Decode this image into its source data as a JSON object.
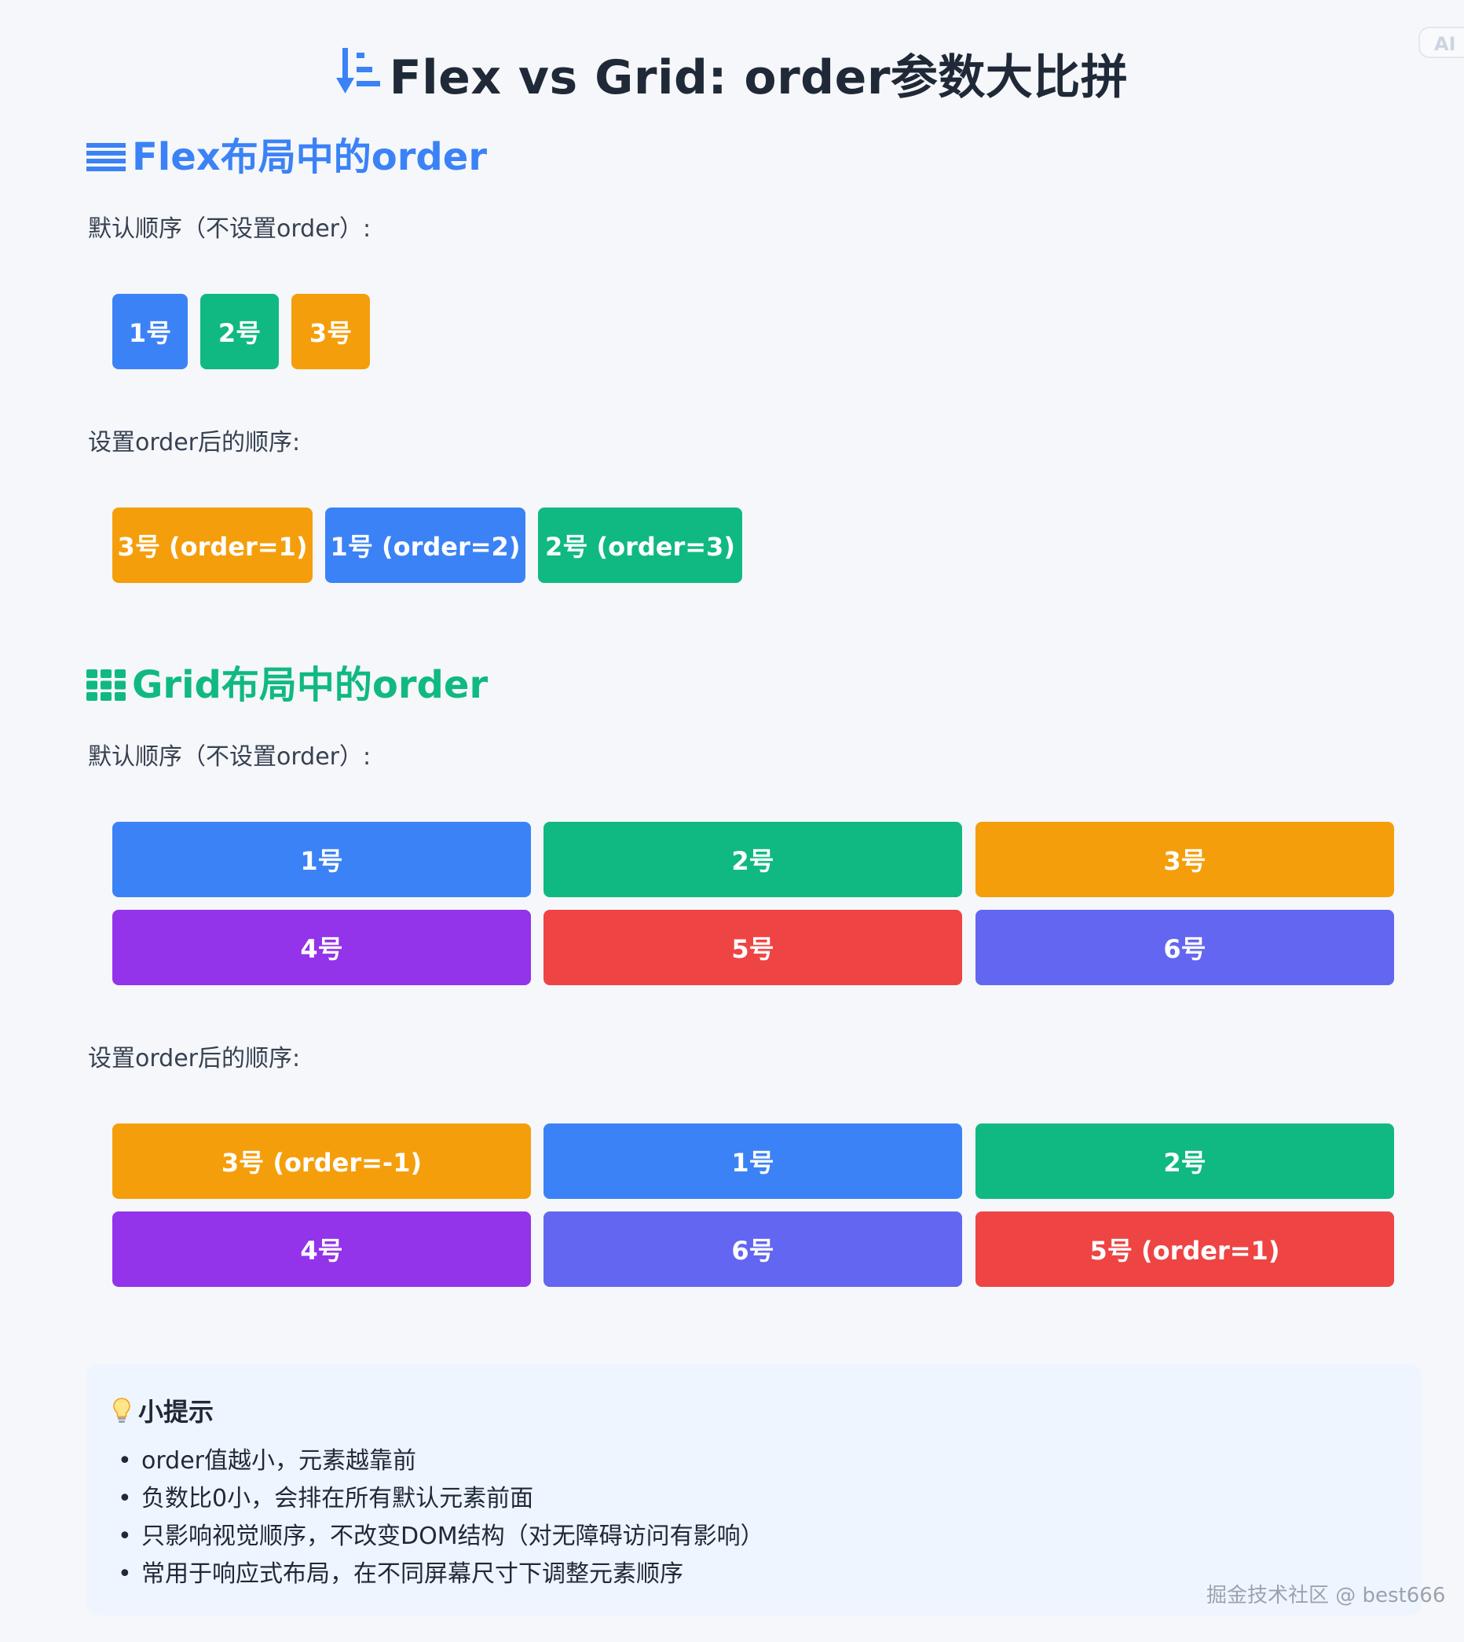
{
  "page": {
    "title": "Flex vs Grid: order参数大比拼",
    "ai_badge": "AI"
  },
  "flex_section": {
    "title": "Flex布局中的order",
    "default_caption": "默认顺序（不设置order）:",
    "default_items": [
      {
        "label": "1号",
        "color": "#3b82f6"
      },
      {
        "label": "2号",
        "color": "#10b981"
      },
      {
        "label": "3号",
        "color": "#f59e0b"
      }
    ],
    "ordered_caption": "设置order后的顺序:",
    "ordered_items": [
      {
        "label": "3号 (order=1)",
        "color": "#f59e0b"
      },
      {
        "label": "1号 (order=2)",
        "color": "#3b82f6"
      },
      {
        "label": "2号 (order=3)",
        "color": "#10b981"
      }
    ]
  },
  "grid_section": {
    "title": "Grid布局中的order",
    "default_caption": "默认顺序（不设置order）:",
    "default_items": [
      {
        "label": "1号",
        "color": "#3b82f6"
      },
      {
        "label": "2号",
        "color": "#10b981"
      },
      {
        "label": "3号",
        "color": "#f59e0b"
      },
      {
        "label": "4号",
        "color": "#9333ea"
      },
      {
        "label": "5号",
        "color": "#ef4444"
      },
      {
        "label": "6号",
        "color": "#6366f1"
      }
    ],
    "ordered_caption": "设置order后的顺序:",
    "ordered_items": [
      {
        "label": "3号 (order=-1)",
        "color": "#f59e0b"
      },
      {
        "label": "1号",
        "color": "#3b82f6"
      },
      {
        "label": "2号",
        "color": "#10b981"
      },
      {
        "label": "4号",
        "color": "#9333ea"
      },
      {
        "label": "6号",
        "color": "#6366f1"
      },
      {
        "label": "5号 (order=1)",
        "color": "#ef4444"
      }
    ]
  },
  "tips": {
    "title": "小提示",
    "items": [
      "order值越小，元素越靠前",
      "负数比0小，会排在所有默认元素前面",
      "只影响视觉顺序，不改变DOM结构（对无障碍访问有影响）",
      "常用于响应式布局，在不同屏幕尺寸下调整元素顺序"
    ]
  },
  "watermark": "掘金技术社区 @ best666",
  "icons": {
    "title": "sort-icon",
    "flex": "list-icon",
    "grid": "grid-icon",
    "tips": "lightbulb-icon"
  }
}
